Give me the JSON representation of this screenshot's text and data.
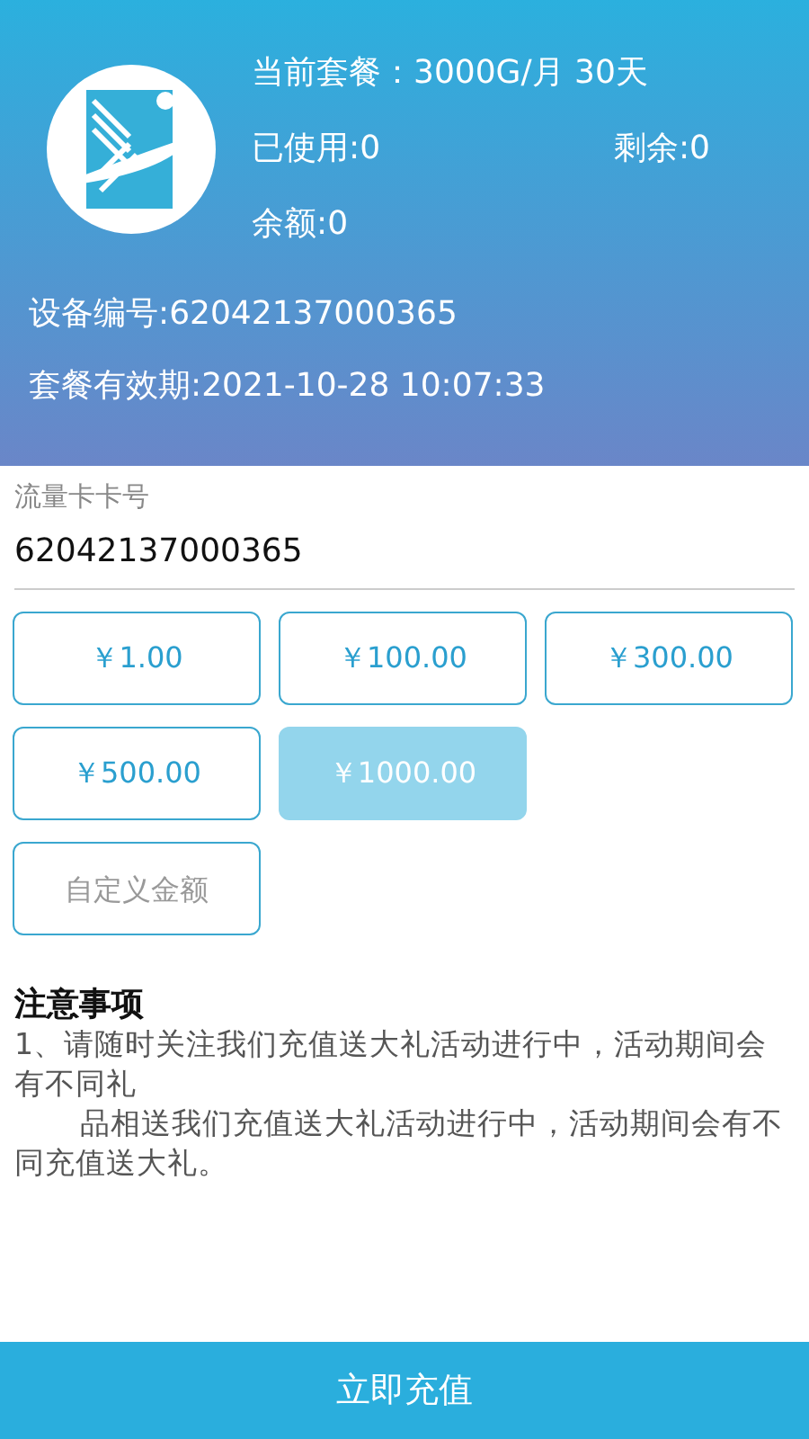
{
  "header": {
    "plan": "当前套餐：3000G/月  30天",
    "used": "已使用:0",
    "remaining": "剩余:0",
    "balance": "余额:0",
    "device": "设备编号:62042137000365",
    "validity": "套餐有效期:2021-10-28 10:07:33"
  },
  "card_field": {
    "label": "流量卡卡号",
    "value": "62042137000365"
  },
  "amounts": [
    {
      "label": "￥1.00",
      "selected": false
    },
    {
      "label": "￥100.00",
      "selected": false
    },
    {
      "label": "￥300.00",
      "selected": false
    },
    {
      "label": "￥500.00",
      "selected": false
    },
    {
      "label": "￥1000.00",
      "selected": true
    }
  ],
  "custom_amount": {
    "placeholder": "自定义金额"
  },
  "notes": {
    "title": "注意事项",
    "paragraphs": [
      {
        "text": "1、请随时关注我们充值送大礼活动进行中，活动期间会有不同礼",
        "indent": false
      },
      {
        "text": "品相送我们充值送大礼活动进行中，活动期间会有不同充值送大礼。",
        "indent": true
      }
    ]
  },
  "submit_button": "立即充值"
}
